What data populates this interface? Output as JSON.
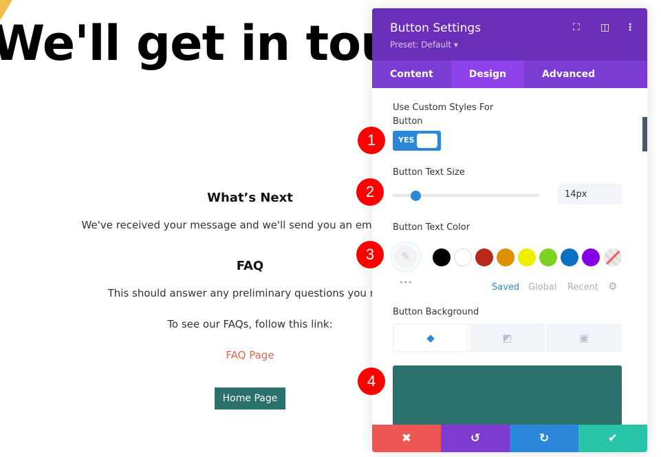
{
  "page": {
    "hero": "We'll get in touch",
    "whats_next": "What’s Next",
    "received": "We've received your message and we'll send you an email within",
    "faq": "FAQ",
    "faq_text": "This should answer any preliminary questions you may",
    "faq_follow": "To see our FAQs, follow this link:",
    "faq_link": "FAQ Page",
    "home_button": "Home Page"
  },
  "panel": {
    "title": "Button Settings",
    "preset": "Preset: Default ▾",
    "tabs": [
      "Content",
      "Design",
      "Advanced"
    ],
    "active_tab": "Design",
    "custom_styles_label": "Use Custom Styles For Button",
    "toggle": "YES",
    "text_size_label": "Button Text Size",
    "text_size": "14px",
    "text_size_value": 14,
    "text_color_label": "Button Text Color",
    "more": "•••",
    "swatches": [
      "#000000",
      "#ffffff",
      "#b8291b",
      "#dd9000",
      "#eeee00",
      "#7cd321",
      "#0c71c3",
      "#8300e9"
    ],
    "palette_tabs": [
      "Saved",
      "Global",
      "Recent"
    ],
    "background_label": "Button Background",
    "background_color": "#2a706b"
  },
  "badges": [
    "1",
    "2",
    "3",
    "4"
  ],
  "footer": {
    "cancel": "✖",
    "undo": "↺",
    "redo": "↻",
    "save": "✔"
  }
}
